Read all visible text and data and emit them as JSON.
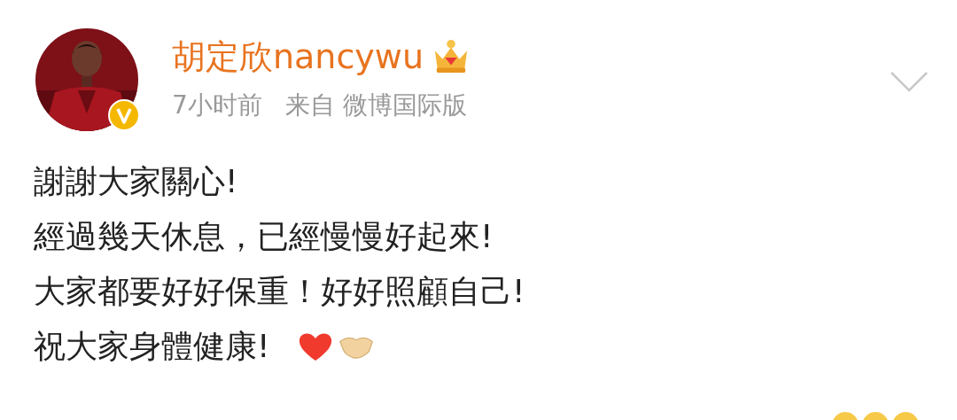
{
  "post": {
    "author": "胡定欣nancywu",
    "time": "7小时前",
    "source": "来自 微博国际版",
    "lines": [
      "謝謝大家關心!",
      "經過幾天休息，已經慢慢好起來!",
      "大家都要好好保重！好好照顧自己!",
      "祝大家身體健康!"
    ]
  }
}
